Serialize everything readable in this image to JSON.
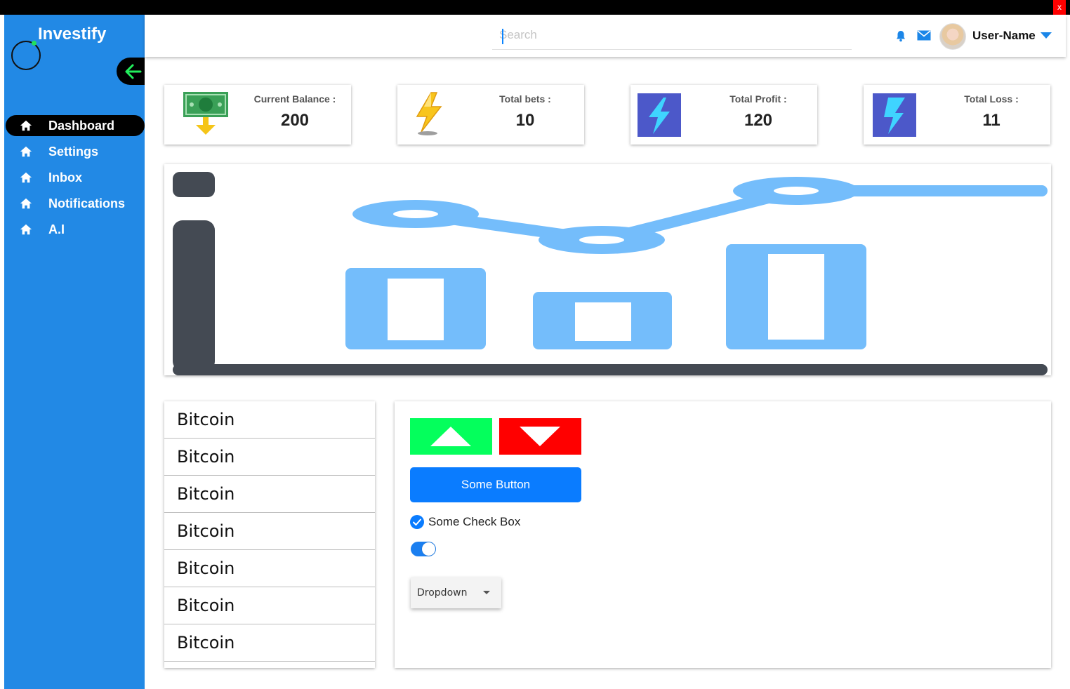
{
  "window": {
    "close_label": "x"
  },
  "sidebar": {
    "brand": "Investify",
    "items": [
      {
        "label": "Dashboard",
        "icon": "home-icon",
        "active": true
      },
      {
        "label": "Settings",
        "icon": "home-icon",
        "active": false
      },
      {
        "label": "Inbox",
        "icon": "home-icon",
        "active": false
      },
      {
        "label": "Notifications",
        "icon": "home-icon",
        "active": false
      },
      {
        "label": "A.I",
        "icon": "home-icon",
        "active": false
      }
    ]
  },
  "header": {
    "search_placeholder": "Search",
    "username": "User-Name"
  },
  "stats": [
    {
      "label": "Current Balance :",
      "value": "200",
      "icon": "money-icon"
    },
    {
      "label": "Total bets :",
      "value": "10",
      "icon": "lightning-icon"
    },
    {
      "label": "Total Profit :",
      "value": "120",
      "icon": "bolt-icon"
    },
    {
      "label": "Total Loss :",
      "value": "11",
      "icon": "bolt-icon"
    }
  ],
  "list": {
    "items": [
      "Bitcoin",
      "Bitcoin",
      "Bitcoin",
      "Bitcoin",
      "Bitcoin",
      "Bitcoin",
      "Bitcoin"
    ]
  },
  "controls": {
    "button_label": "Some Button",
    "checkbox_label": "Some Check Box",
    "checkbox_checked": true,
    "toggle_on": true,
    "dropdown_value": "Dropdown"
  },
  "colors": {
    "sidebar": "#2289e5",
    "up": "#04ff5c",
    "down": "#ff0000",
    "primary_button": "#0a7cff",
    "chart_light_blue": "#74bdfb",
    "chart_dark": "#444a53"
  }
}
